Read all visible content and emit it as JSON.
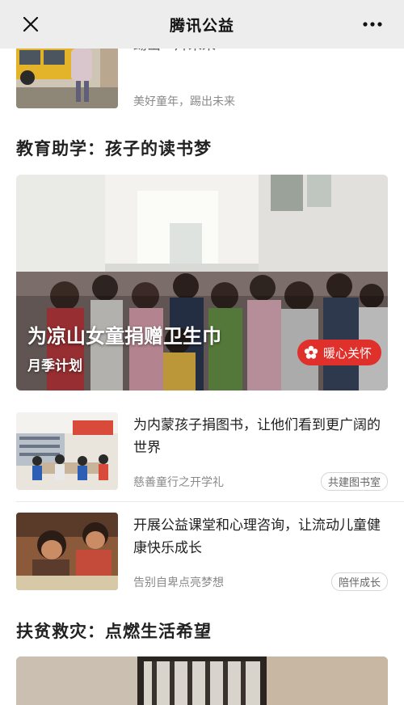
{
  "nav": {
    "title": "腾讯公益",
    "close_icon": "close-icon",
    "more_icon": "more-icon"
  },
  "top_article": {
    "title_partial": "踢出一片未来",
    "subtitle": "美好童年，踢出未来"
  },
  "section_education": {
    "title": "教育助学：孩子的读书梦"
  },
  "banner": {
    "title": "为凉山女童捐赠卫生巾",
    "subtitle": "月季计划",
    "button_label": "暖心关怀",
    "button_icon": "flower-icon"
  },
  "articles": [
    {
      "title": "为内蒙孩子捐图书，让他们看到更广阔的世界",
      "subtitle": "慈善童行之开学礼",
      "tag": "共建图书室"
    },
    {
      "title": "开展公益课堂和心理咨询，让流动儿童健康快乐成长",
      "subtitle": "告别自卑点亮梦想",
      "tag": "陪伴成长"
    }
  ],
  "section_poverty": {
    "title": "扶贫救灾：点燃生活希望"
  },
  "colors": {
    "nav_bg": "#ededed",
    "accent_red": "#e0302b",
    "subtext": "#8a8a8a"
  }
}
